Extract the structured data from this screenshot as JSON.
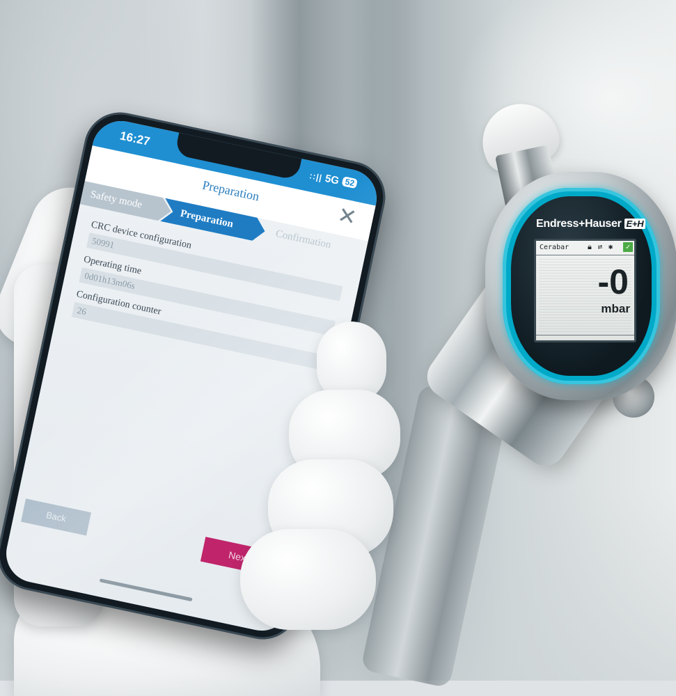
{
  "phone": {
    "status_time": "16:27",
    "status_signal": "::||",
    "status_network": "5G",
    "status_battery": "52",
    "title": "Preparation",
    "steps": [
      "Safety mode",
      "Preparation",
      "Confirmation"
    ],
    "fields": [
      {
        "label": "CRC device configuration",
        "value": "50991"
      },
      {
        "label": "Operating time",
        "value": "0d01h13m06s"
      },
      {
        "label": "Configuration counter",
        "value": "26"
      }
    ],
    "back_button": "Back",
    "next_button": "Next"
  },
  "device": {
    "brand": "Endress+Hauser",
    "brand_logo": "E+H",
    "lcd_tag": "Cerabar",
    "lcd_value": "-0",
    "lcd_unit": "mbar",
    "lcd_icons": [
      "lock-icon",
      "sync-icon",
      "bluetooth-icon",
      "check-icon"
    ]
  },
  "colors": {
    "app_blue": "#1f8fd2",
    "step_active": "#1f7cc3",
    "next_button": "#c0246b",
    "bezel_cyan": "#00a9c8"
  }
}
